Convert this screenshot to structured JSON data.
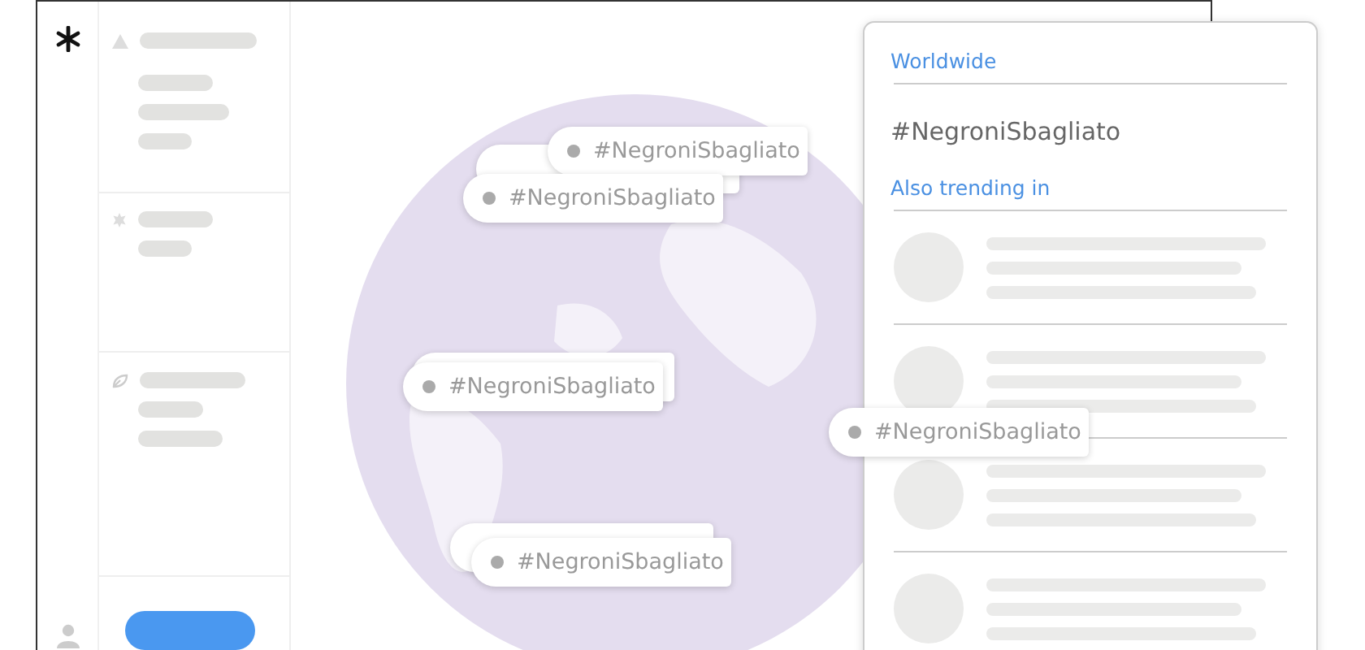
{
  "panel": {
    "location": "Worldwide",
    "trend": "#NegroniSbagliato",
    "also_label": "Also trending in"
  },
  "map_tags": [
    {
      "label": "#NegroniSbagliato"
    },
    {
      "label": "#NegroniSbagliato"
    },
    {
      "label": "#NegroniSbagliato"
    },
    {
      "label": "#NegroniSbagliato"
    },
    {
      "label": "#NegroniSbagliato"
    }
  ]
}
